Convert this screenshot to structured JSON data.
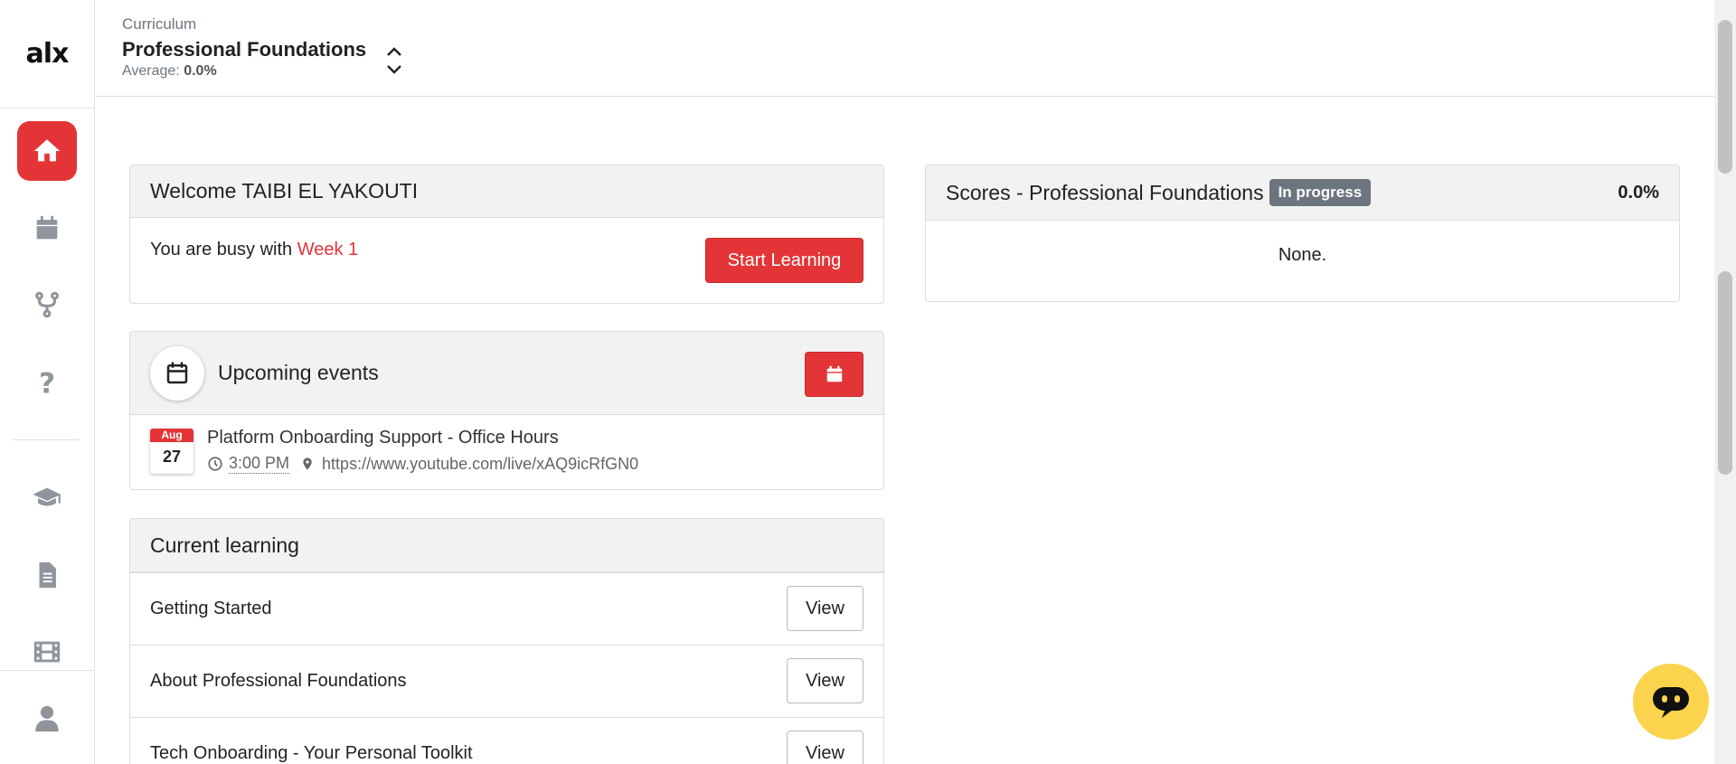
{
  "sidebar": {
    "logo": "alx",
    "items": [
      {
        "name": "home",
        "icon": "home-icon",
        "active": true
      },
      {
        "name": "calendar",
        "icon": "calendar-icon"
      },
      {
        "name": "projects",
        "icon": "fork-icon"
      },
      {
        "name": "help",
        "icon": "question-icon"
      },
      {
        "name": "courses",
        "icon": "graduation-cap-icon"
      },
      {
        "name": "documents",
        "icon": "document-icon"
      },
      {
        "name": "videos",
        "icon": "film-icon"
      },
      {
        "name": "profile",
        "icon": "user-icon"
      }
    ]
  },
  "header": {
    "label": "Curriculum",
    "title": "Professional Foundations",
    "average_label": "Average:",
    "average_value": "0.0%"
  },
  "welcome": {
    "title": "Welcome TAIBI EL YAKOUTI",
    "busy_prefix": "You are busy with",
    "busy_link": "Week 1",
    "button": "Start Learning"
  },
  "events": {
    "title": "Upcoming events",
    "items": [
      {
        "month": "Aug",
        "day": "27",
        "name": "Platform Onboarding Support - Office Hours",
        "time": "3:00 PM",
        "location": "https://www.youtube.com/live/xAQ9icRfGN0"
      }
    ]
  },
  "current_learning": {
    "title": "Current learning",
    "button_label": "View",
    "items": [
      "Getting Started",
      "About Professional Foundations",
      "Tech Onboarding - Your Personal Toolkit"
    ]
  },
  "scores": {
    "title": "Scores - Professional Foundations",
    "status": "In progress",
    "value": "0.0%",
    "empty": "None."
  },
  "colors": {
    "accent": "#e33537",
    "badge": "#6c757d",
    "chat": "#fcd34d"
  }
}
